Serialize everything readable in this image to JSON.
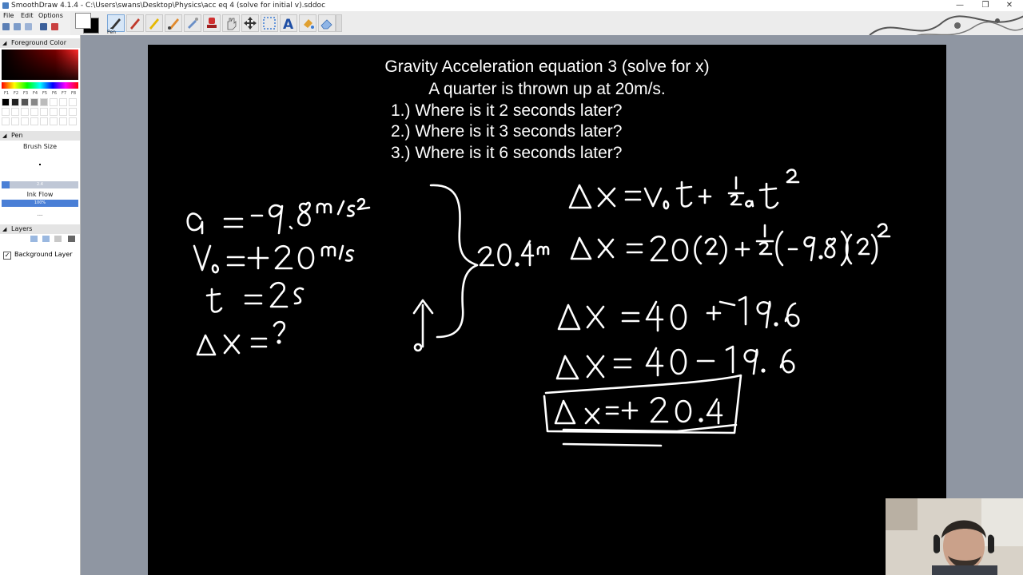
{
  "window": {
    "title": "SmoothDraw 4.1.4 - C:\\Users\\swans\\Desktop\\Physics\\acc eq 4 (solve for initial v).sddoc",
    "minimize_glyph": "—",
    "restore_glyph": "❒",
    "close_glyph": "✕"
  },
  "menu": {
    "file": "File",
    "edit": "Edit",
    "options": "Options"
  },
  "toolbar": {
    "active_tool_label": "Pen",
    "tools": [
      "pen-icon",
      "pencil-icon",
      "marker-icon",
      "brush-icon",
      "airbrush-icon",
      "stamp-icon",
      "hand-icon",
      "move-icon",
      "select-icon",
      "text-icon",
      "fill-icon",
      "eraser-icon"
    ]
  },
  "panel": {
    "foreground_header": "Foreground Color",
    "fkeys": [
      "F1",
      "F2",
      "F3",
      "F4",
      "F5",
      "F6",
      "F7",
      "F8"
    ],
    "pen_header": "Pen",
    "brush_size_label": "Brush Size",
    "brush_size_value": "2.4",
    "ink_flow_label": "Ink Flow",
    "ink_flow_value": "100%",
    "more_dots": "...",
    "layers_header": "Layers",
    "layer_name": "Background Layer",
    "layer_checked": "✓"
  },
  "board": {
    "heading_line1": "Gravity Acceleration equation 3 (solve for x)",
    "heading_line2": "A quarter is thrown up at 20m/s.",
    "q1": "1.) Where is it 2 seconds later?",
    "q2": "2.) Where is it 3 seconds later?",
    "q3": "3.) Where is it 6 seconds later?"
  },
  "colors": {
    "board_bg": "#000000",
    "ink": "#ffffff",
    "workspace_bg": "#8f96a2",
    "slider_fill": "#4a7fd6"
  }
}
